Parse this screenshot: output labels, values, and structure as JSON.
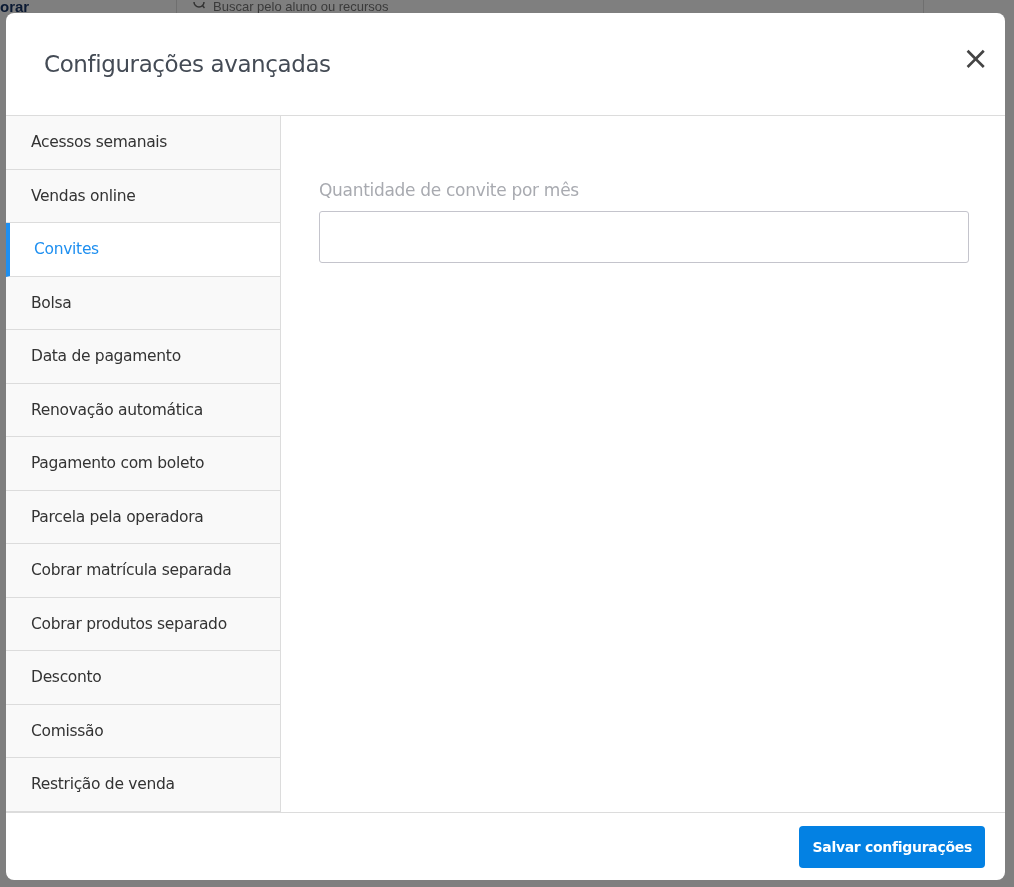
{
  "background": {
    "brand_fragment": "orar",
    "search": {
      "placeholder": "Buscar pelo aluno ou recursos"
    }
  },
  "dialog": {
    "title": "Configurações avançadas",
    "close": "×",
    "sidebar": {
      "items": [
        {
          "label": "Acessos semanais",
          "selected": false
        },
        {
          "label": "Vendas online",
          "selected": false
        },
        {
          "label": "Convites",
          "selected": true
        },
        {
          "label": "Bolsa",
          "selected": false
        },
        {
          "label": "Data de pagamento",
          "selected": false
        },
        {
          "label": "Renovação automática",
          "selected": false
        },
        {
          "label": "Pagamento com boleto",
          "selected": false
        },
        {
          "label": "Parcela pela operadora",
          "selected": false
        },
        {
          "label": "Cobrar matrícula separada",
          "selected": false
        },
        {
          "label": "Cobrar produtos separado",
          "selected": false
        },
        {
          "label": "Desconto",
          "selected": false
        },
        {
          "label": "Comissão",
          "selected": false
        },
        {
          "label": "Restrição de venda",
          "selected": false
        }
      ]
    },
    "field": {
      "label": "Quantidade de convite por mês"
    },
    "save_button": "Salvar configurações"
  }
}
